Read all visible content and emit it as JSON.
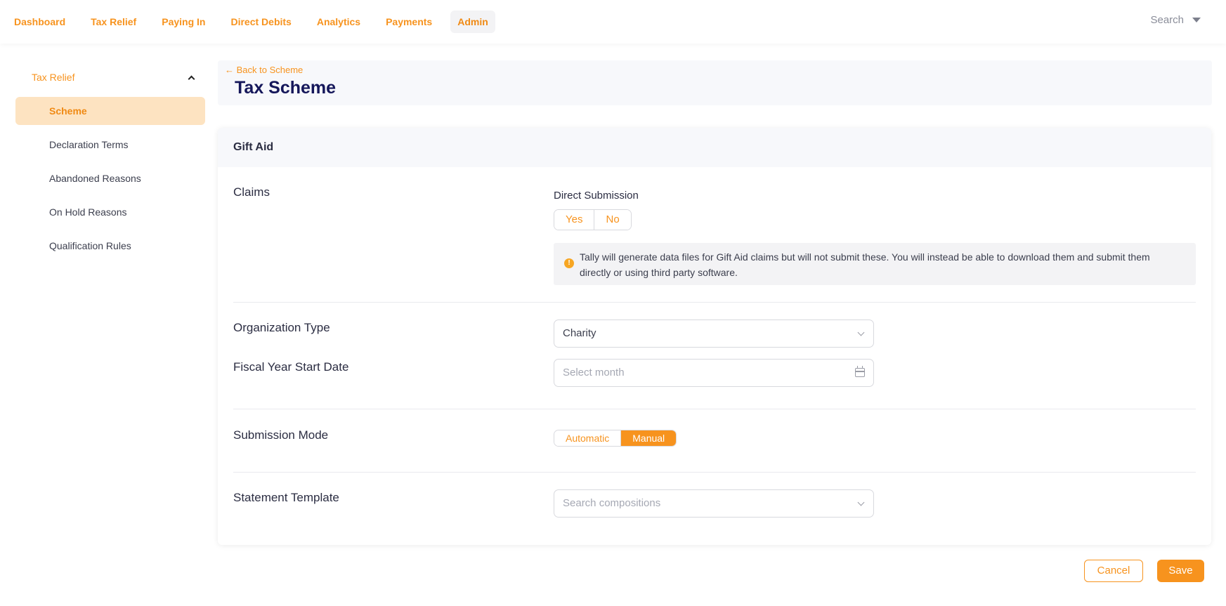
{
  "nav": {
    "items": [
      {
        "label": "Dashboard"
      },
      {
        "label": "Tax Relief"
      },
      {
        "label": "Paying In"
      },
      {
        "label": "Direct Debits"
      },
      {
        "label": "Analytics"
      },
      {
        "label": "Payments"
      },
      {
        "label": "Admin",
        "active": true
      }
    ],
    "search_label": "Search"
  },
  "sidebar": {
    "group_label": "Tax Relief",
    "items": [
      {
        "label": "Scheme",
        "active": true
      },
      {
        "label": "Declaration Terms"
      },
      {
        "label": "Abandoned Reasons"
      },
      {
        "label": "On Hold Reasons"
      },
      {
        "label": "Qualification Rules"
      }
    ]
  },
  "header": {
    "back_link": "Back to Scheme",
    "title": "Tax Scheme"
  },
  "card": {
    "title": "Gift Aid",
    "claims": {
      "label": "Claims",
      "direct_submission_label": "Direct Submission",
      "yes_label": "Yes",
      "no_label": "No",
      "info_icon": "!",
      "info_text": "Tally will generate data files for Gift Aid claims but will not submit these. You will instead be able to download them and submit them directly or using third party software."
    },
    "organization_type": {
      "label": "Organization Type",
      "value": "Charity"
    },
    "fiscal_year": {
      "label": "Fiscal Year Start Date",
      "placeholder": "Select month"
    },
    "submission_mode": {
      "label": "Submission Mode",
      "automatic_label": "Automatic",
      "manual_label": "Manual",
      "selected": "Manual"
    },
    "statement_template": {
      "label": "Statement Template",
      "placeholder": "Search compositions"
    }
  },
  "footer": {
    "cancel_label": "Cancel",
    "save_label": "Save"
  },
  "colors": {
    "accent": "#f7931e",
    "title": "#15175a",
    "active_sidebar_bg": "#fde3c1"
  }
}
